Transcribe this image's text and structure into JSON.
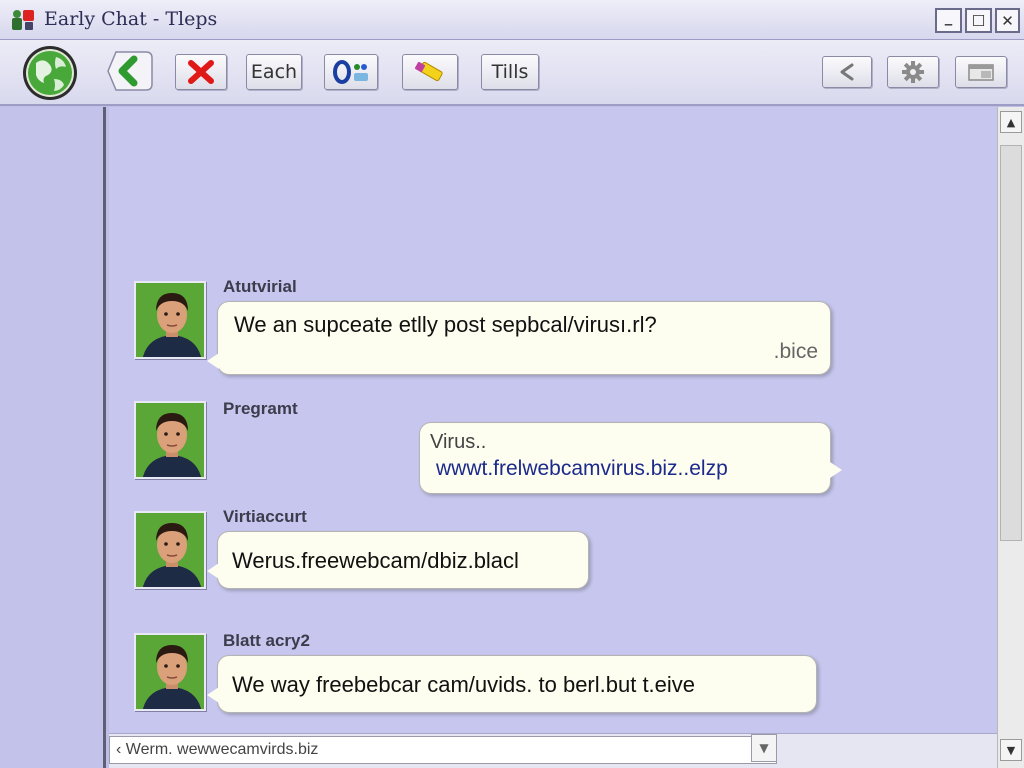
{
  "window": {
    "title": "Early Chat - Tleps",
    "minimize_glyph": "_",
    "maximize_glyph": "☐",
    "close_glyph": "✕"
  },
  "toolbar": {
    "buttons": [
      {
        "name": "home-globe-icon",
        "label": ""
      },
      {
        "name": "back-icon",
        "label": ""
      },
      {
        "name": "stop-icon",
        "label": ""
      },
      {
        "name": "each",
        "label": "Each"
      },
      {
        "name": "emoticons-icon",
        "label": ""
      },
      {
        "name": "highlight-icon",
        "label": ""
      },
      {
        "name": "tills",
        "label": "Tills"
      },
      {
        "name": "share-icon",
        "label": ""
      },
      {
        "name": "gear-icon",
        "label": ""
      },
      {
        "name": "window-icon",
        "label": ""
      }
    ],
    "each_label": "Each",
    "tills_label": "Tills"
  },
  "messages": [
    {
      "sender": "Atutvirial",
      "line1": "We an supceate etlly post sepbcal/virusı.rl?",
      "line2": ".bice"
    },
    {
      "sender": "Pregramt",
      "line1": "Virus..",
      "line2": "wwwt.frelwebcamvirus.biz..elzp"
    },
    {
      "sender": "Virtiaccurt",
      "line1": "Werus.freewebcam/dbiz.blacl"
    },
    {
      "sender": "Blatt acry2",
      "line1": "We way freebebcar cam/uvids. to berl.but t.eive"
    }
  ],
  "input": {
    "value": "‹ Werm. wewwecamvirds.biz"
  },
  "colors": {
    "background": "#bebee6",
    "bubble": "#fdfdf0",
    "link": "#1c2a8c",
    "avatar_bg": "#5aa636"
  }
}
